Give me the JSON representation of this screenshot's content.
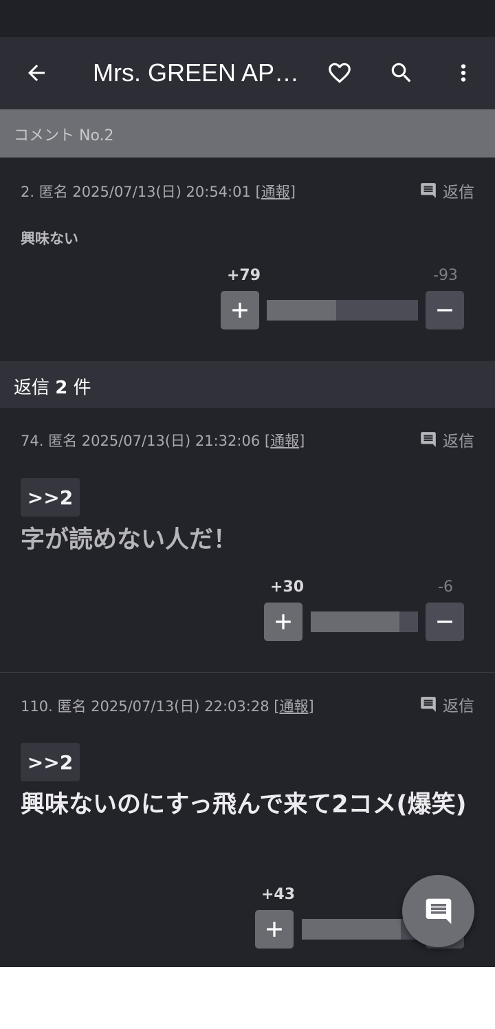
{
  "app_bar": {
    "title": "Mrs. GREEN APPLE"
  },
  "section": {
    "label": "コメント No.2"
  },
  "main_comment": {
    "number": "2.",
    "author": "匿名",
    "datetime": "2025/07/13(日) 20:54:01",
    "report_label": "通報",
    "reply_label": "返信",
    "body": "興味ない",
    "plus_count": "+79",
    "minus_count": "-93",
    "positive_ratio": 0.46
  },
  "replies_header": {
    "prefix": "返信",
    "count": "2",
    "suffix": "件"
  },
  "replies": [
    {
      "number": "74.",
      "author": "匿名",
      "datetime": "2025/07/13(日) 21:32:06",
      "report_label": "通報",
      "reply_label": "返信",
      "anchor": ">>2",
      "body": "字が読めない人だ！",
      "plus_count": "+30",
      "minus_count": "-6",
      "positive_ratio": 0.83
    },
    {
      "number": "110.",
      "author": "匿名",
      "datetime": "2025/07/13(日) 22:03:28",
      "report_label": "通報",
      "reply_label": "返信",
      "anchor": ">>2",
      "body": "興味ないのにすっ飛んで来て2コメ(爆笑)",
      "plus_count": "+43",
      "positive_ratio": 0.85
    }
  ],
  "icons": {
    "back": "arrow-back-icon",
    "favorite": "heart-outline-icon",
    "search": "search-icon",
    "more": "more-vert-icon",
    "reply": "comment-icon",
    "plus": "plus-icon",
    "minus": "minus-icon",
    "fab": "comment-icon"
  }
}
